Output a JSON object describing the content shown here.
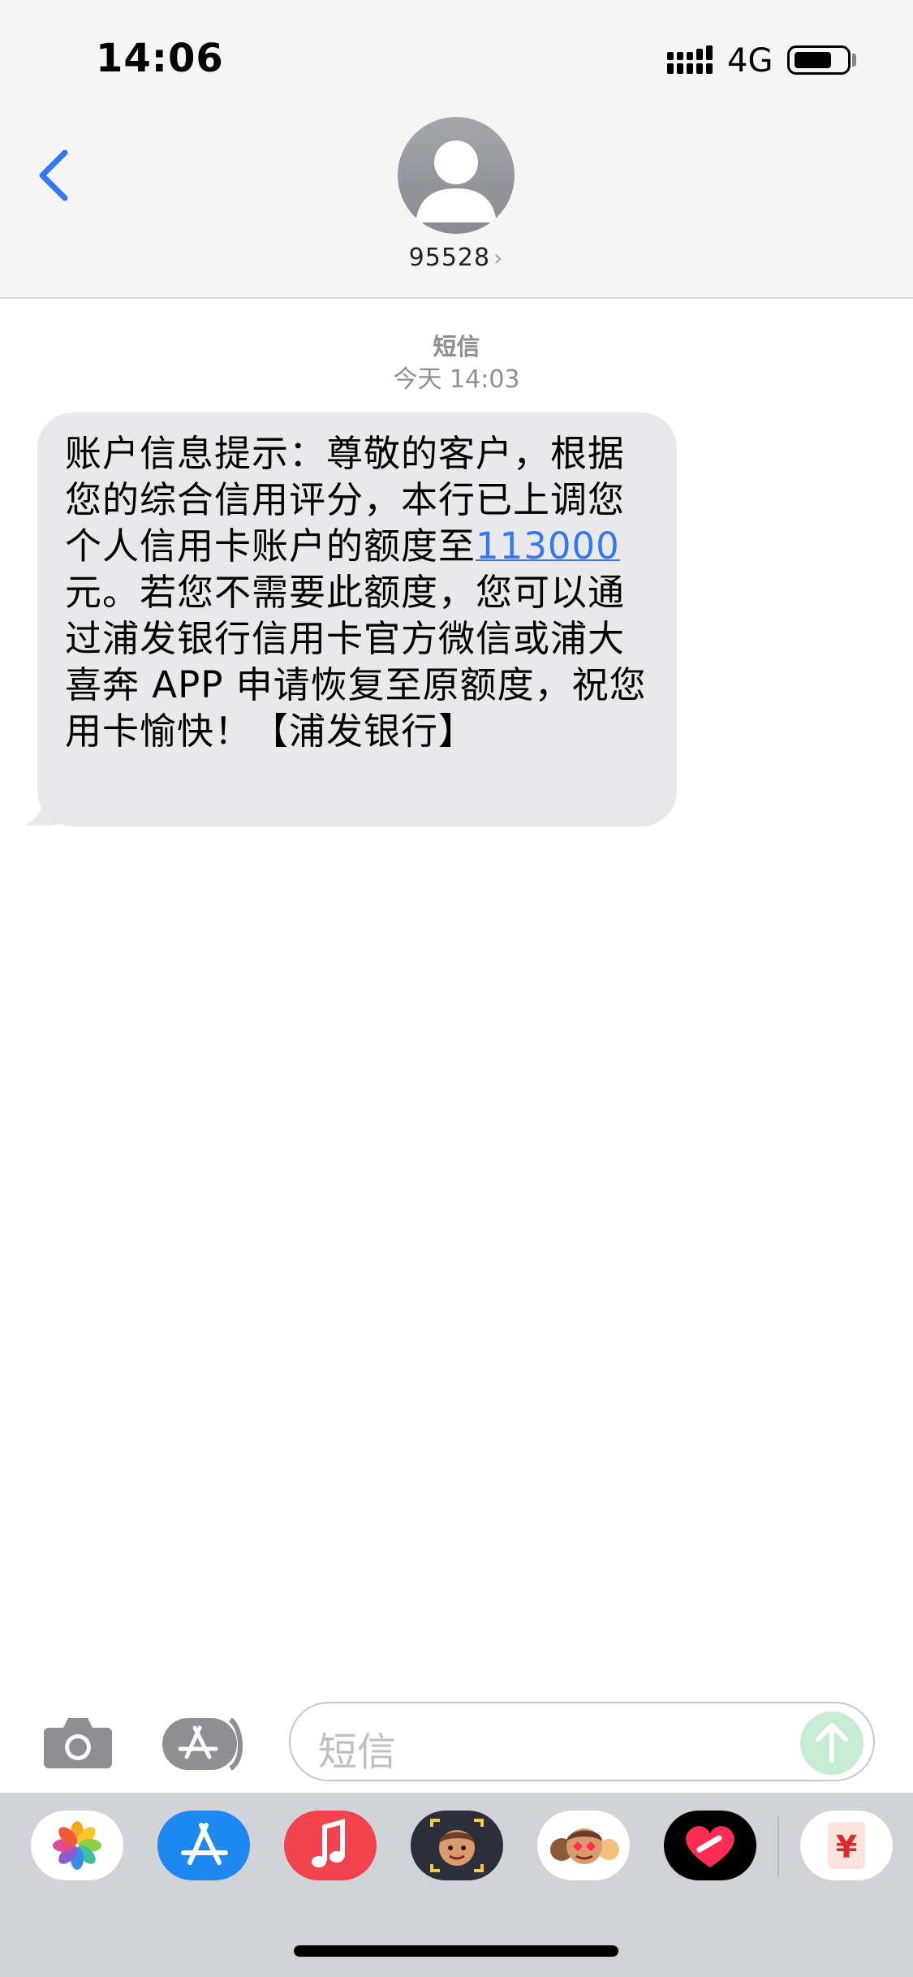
{
  "status_bar": {
    "time": "14:06",
    "network": "4G",
    "battery_level": 0.75
  },
  "header": {
    "contact": "95528",
    "icons": [
      "back-chevron-icon",
      "contact-avatar-icon",
      "chevron-right-icon"
    ]
  },
  "thread": {
    "service_label": "短信",
    "timestamp": "今天 14:03",
    "message": {
      "before": "账户信息提示：尊敬的客户，根据您的综合信用评分，本行已上调您个人信用卡账户的额度至",
      "amount": "113000",
      "after": "元。若您不需要此额度，您可以通过浦发银行信用卡官方微信或浦大喜奔 APP 申请恢复至原额度，祝您用卡愉快！【浦发银行】"
    }
  },
  "input_bar": {
    "placeholder": "短信",
    "icons": [
      "camera-icon",
      "app-store-icon",
      "send-arrow-icon"
    ]
  },
  "app_drawer": {
    "apps": [
      "photos-app-icon",
      "app-store-app-icon",
      "music-app-icon",
      "memoji-camera-app-icon",
      "memoji-stickers-app-icon",
      "digital-touch-app-icon",
      "yuan-app-icon"
    ],
    "yuan_glyph": "¥",
    "colors": {
      "app_store": "#1e88f0",
      "music": "#f0434d",
      "touch_bg": "#000000",
      "heart": "#ff2d55"
    }
  },
  "colors": {
    "link": "#3478f6",
    "bubble": "#e9e9eb",
    "back": "#3478f6",
    "send": "#c7ecd3"
  }
}
